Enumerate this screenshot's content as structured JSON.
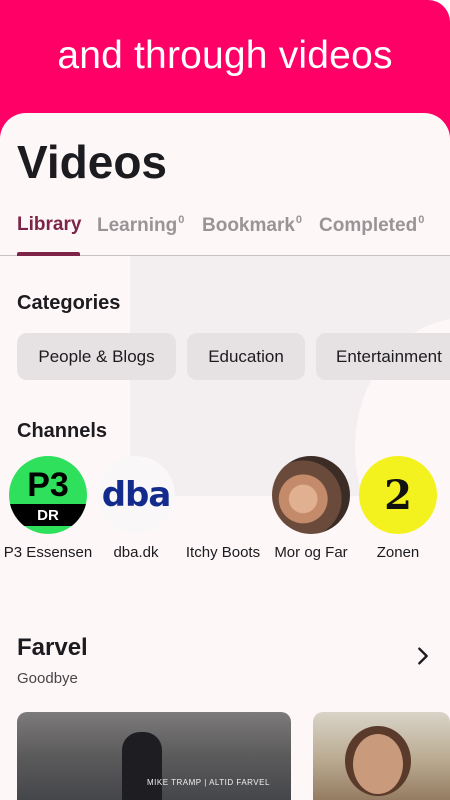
{
  "banner": {
    "title": "and through videos"
  },
  "page": {
    "title": "Videos"
  },
  "tabs": [
    {
      "label": "Library",
      "count": ""
    },
    {
      "label": "Learning",
      "count": "0"
    },
    {
      "label": "Bookmark",
      "count": "0"
    },
    {
      "label": "Completed",
      "count": "0"
    }
  ],
  "categories": {
    "title": "Categories",
    "items": [
      "People & Blogs",
      "Education",
      "Entertainment"
    ]
  },
  "channels": {
    "title": "Channels",
    "items": [
      {
        "name": "P3 Essensen",
        "logo_text": "P3",
        "logo_sub": "DR"
      },
      {
        "name": "dba.dk",
        "logo_text": "dba"
      },
      {
        "name": "Itchy Boots"
      },
      {
        "name": "Mor og Far"
      },
      {
        "name": "Zonen",
        "logo_text": "2"
      }
    ]
  },
  "playlist": {
    "title": "Farvel",
    "subtitle": "Goodbye",
    "videos": [
      {
        "caption": "MIKE TRAMP | ALTID FARVEL"
      },
      {
        "caption": ""
      }
    ]
  },
  "colors": {
    "banner": "#ff0066",
    "accent": "#7d2448",
    "chip": "#e6e1e3",
    "background": "#fdf7f8"
  }
}
